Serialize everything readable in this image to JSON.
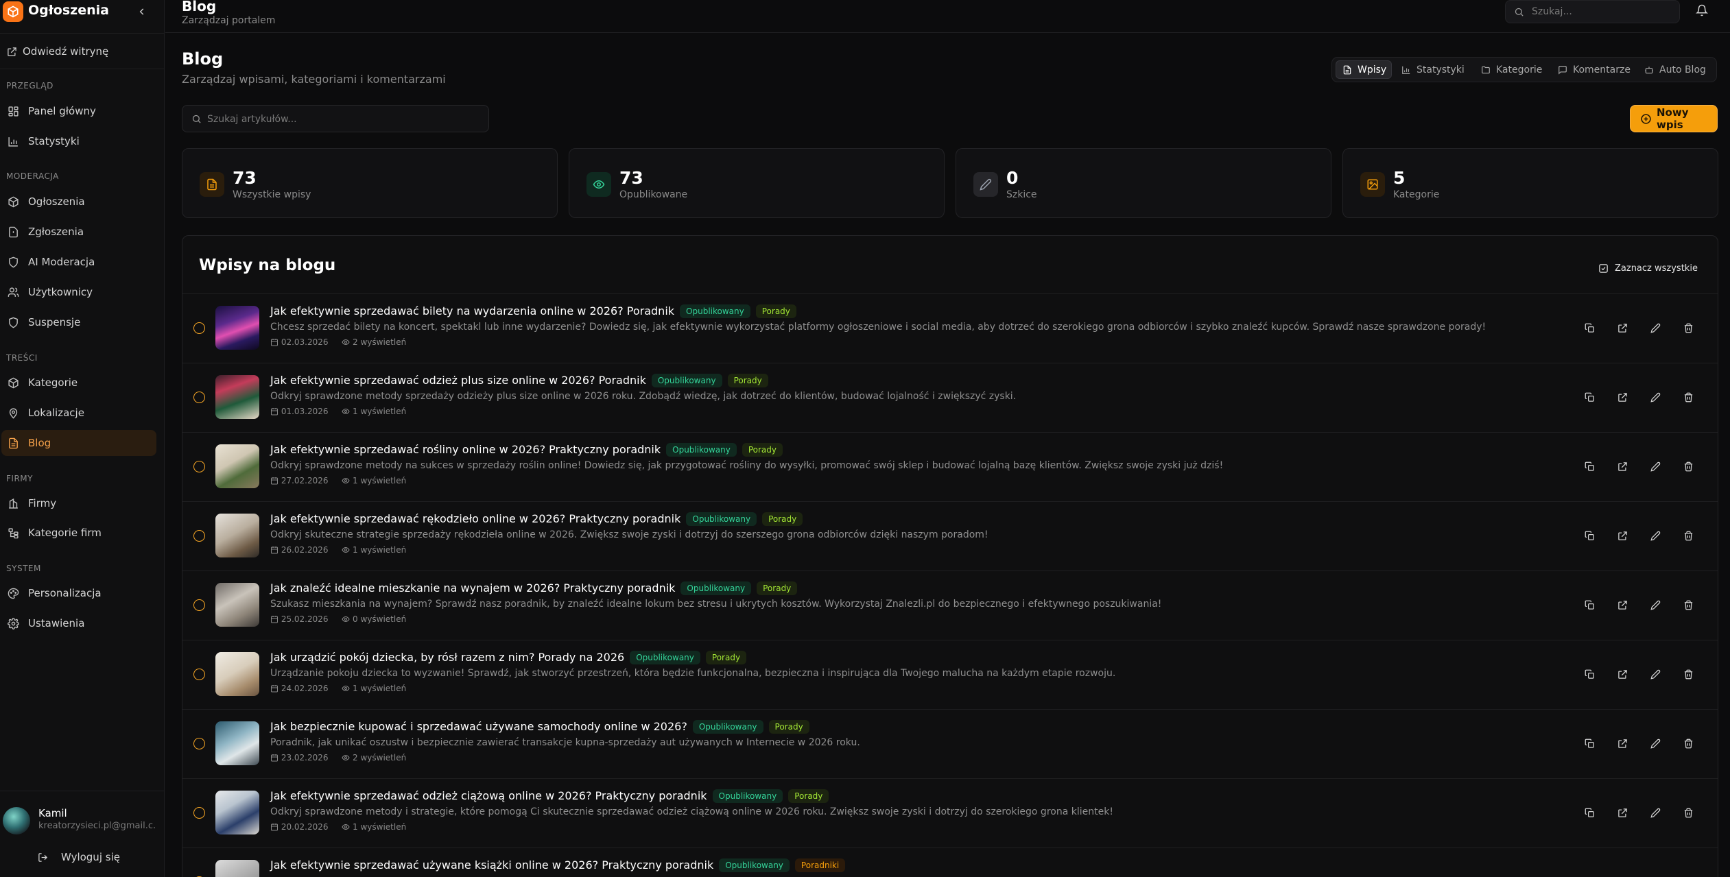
{
  "sidebar": {
    "brand": "Ogłoszenia",
    "visit_site": "Odwiedź witrynę",
    "sections": [
      {
        "label": "PRZEGLĄD",
        "items": [
          {
            "label": "Panel główny",
            "icon": "dashboard-icon"
          },
          {
            "label": "Statystyki",
            "icon": "bar-chart-icon"
          }
        ]
      },
      {
        "label": "MODERACJA",
        "items": [
          {
            "label": "Ogłoszenia",
            "icon": "package-icon"
          },
          {
            "label": "Zgłoszenia",
            "icon": "alert-file-icon"
          },
          {
            "label": "AI Moderacja",
            "icon": "shield-icon"
          },
          {
            "label": "Użytkownicy",
            "icon": "users-icon"
          },
          {
            "label": "Suspensje",
            "icon": "shield-icon"
          }
        ]
      },
      {
        "label": "TREŚCI",
        "items": [
          {
            "label": "Kategorie",
            "icon": "package-icon"
          },
          {
            "label": "Lokalizacje",
            "icon": "map-pin-icon"
          },
          {
            "label": "Blog",
            "icon": "file-text-icon",
            "active": true
          }
        ]
      },
      {
        "label": "FIRMY",
        "items": [
          {
            "label": "Firmy",
            "icon": "building-icon"
          },
          {
            "label": "Kategorie firm",
            "icon": "tree-icon"
          }
        ]
      },
      {
        "label": "SYSTEM",
        "items": [
          {
            "label": "Personalizacja",
            "icon": "palette-icon"
          },
          {
            "label": "Ustawienia",
            "icon": "gear-icon"
          }
        ]
      }
    ],
    "user": {
      "name": "Kamil",
      "email": "kreatorzysieci.pl@gmail.c..."
    },
    "logout": "Wyloguj się"
  },
  "topbar": {
    "title": "Blog",
    "subtitle": "Zarządzaj portalem",
    "search_placeholder": "Szukaj..."
  },
  "page": {
    "title": "Blog",
    "subtitle": "Zarządzaj wpisami, kategoriami i komentarzami",
    "tabs": [
      {
        "label": "Wpisy",
        "icon": "file-text-icon",
        "active": true
      },
      {
        "label": "Statystyki",
        "icon": "bar-chart-icon"
      },
      {
        "label": "Kategorie",
        "icon": "folder-icon"
      },
      {
        "label": "Komentarze",
        "icon": "message-icon"
      },
      {
        "label": "Auto Blog",
        "icon": "robot-icon"
      }
    ],
    "search_placeholder": "Szukaj artykułów...",
    "new_button": "Nowy wpis",
    "accent": "#f59e0b"
  },
  "stats": [
    {
      "value": "73",
      "label": "Wszystkie wpisy",
      "icon": "file-text-icon",
      "color": "#f59e0b"
    },
    {
      "value": "73",
      "label": "Opublikowane",
      "icon": "eye-icon",
      "color": "#34d399"
    },
    {
      "value": "0",
      "label": "Szkice",
      "icon": "pencil-icon",
      "color": "#9ca3af"
    },
    {
      "value": "5",
      "label": "Kategorie",
      "icon": "image-icon",
      "color": "#f59e0b"
    }
  ],
  "list": {
    "title": "Wpisy na blogu",
    "select_all": "Zaznacz wszystkie",
    "posts": [
      {
        "title": "Jak efektywnie sprzedawać bilety na wydarzenia online w 2026? Poradnik",
        "status": "Opublikowany",
        "category": "Porady",
        "excerpt": "Chcesz sprzedać bilety na koncert, spektakl lub inne wydarzenie? Dowiedz się, jak efektywnie wykorzystać platformy ogłoszeniowe i social media, aby dotrzeć do szerokiego grona odbiorców i szybko znaleźć kupców. Sprawdź nasze sprawdzone porady!",
        "date": "02.03.2026",
        "views": "2 wyświetleń"
      },
      {
        "title": "Jak efektywnie sprzedawać odzież plus size online w 2026? Poradnik",
        "status": "Opublikowany",
        "category": "Porady",
        "excerpt": "Odkryj sprawdzone metody sprzedaży odzieży plus size online w 2026 roku. Zdobądź wiedzę, jak dotrzeć do klientów, budować lojalność i zwiększyć zyski.",
        "date": "01.03.2026",
        "views": "1 wyświetleń"
      },
      {
        "title": "Jak efektywnie sprzedawać rośliny online w 2026? Praktyczny poradnik",
        "status": "Opublikowany",
        "category": "Porady",
        "excerpt": "Odkryj sprawdzone metody na sukces w sprzedaży roślin online! Dowiedz się, jak przygotować rośliny do wysyłki, promować swój sklep i budować lojalną bazę klientów. Zwiększ swoje zyski już dziś!",
        "date": "27.02.2026",
        "views": "1 wyświetleń"
      },
      {
        "title": "Jak efektywnie sprzedawać rękodzieło online w 2026? Praktyczny poradnik",
        "status": "Opublikowany",
        "category": "Porady",
        "excerpt": "Odkryj skuteczne strategie sprzedaży rękodzieła online w 2026. Zwiększ swoje zyski i dotrzyj do szerszego grona odbiorców dzięki naszym poradom!",
        "date": "26.02.2026",
        "views": "1 wyświetleń"
      },
      {
        "title": "Jak znaleźć idealne mieszkanie na wynajem w 2026? Praktyczny poradnik",
        "status": "Opublikowany",
        "category": "Porady",
        "excerpt": "Szukasz mieszkania na wynajem? Sprawdź nasz poradnik, by znaleźć idealne lokum bez stresu i ukrytych kosztów. Wykorzystaj Znalezli.pl do bezpiecznego i efektywnego poszukiwania!",
        "date": "25.02.2026",
        "views": "0 wyświetleń"
      },
      {
        "title": "Jak urządzić pokój dziecka, by rósł razem z nim? Porady na 2026",
        "status": "Opublikowany",
        "category": "Porady",
        "excerpt": "Urządzanie pokoju dziecka to wyzwanie! Sprawdź, jak stworzyć przestrzeń, która będzie funkcjonalna, bezpieczna i inspirująca dla Twojego malucha na każdym etapie rozwoju.",
        "date": "24.02.2026",
        "views": "1 wyświetleń"
      },
      {
        "title": "Jak bezpiecznie kupować i sprzedawać używane samochody online w 2026?",
        "status": "Opublikowany",
        "category": "Porady",
        "excerpt": "Poradnik, jak unikać oszustw i bezpiecznie zawierać transakcje kupna-sprzedaży aut używanych w Internecie w 2026 roku.",
        "date": "23.02.2026",
        "views": "2 wyświetleń"
      },
      {
        "title": "Jak efektywnie sprzedawać odzież ciążową online w 2026? Praktyczny poradnik",
        "status": "Opublikowany",
        "category": "Porady",
        "excerpt": "Odkryj sprawdzone metody i strategie, które pomogą Ci skutecznie sprzedawać odzież ciążową online w 2026 roku. Zwiększ swoje zyski i dotrzyj do szerokiego grona klientek!",
        "date": "20.02.2026",
        "views": "1 wyświetleń"
      },
      {
        "title": "Jak efektywnie sprzedawać używane książki online w 2026? Praktyczny poradnik",
        "status": "Opublikowany",
        "category": "Poradniki",
        "excerpt": "",
        "date": "",
        "views": ""
      }
    ]
  }
}
